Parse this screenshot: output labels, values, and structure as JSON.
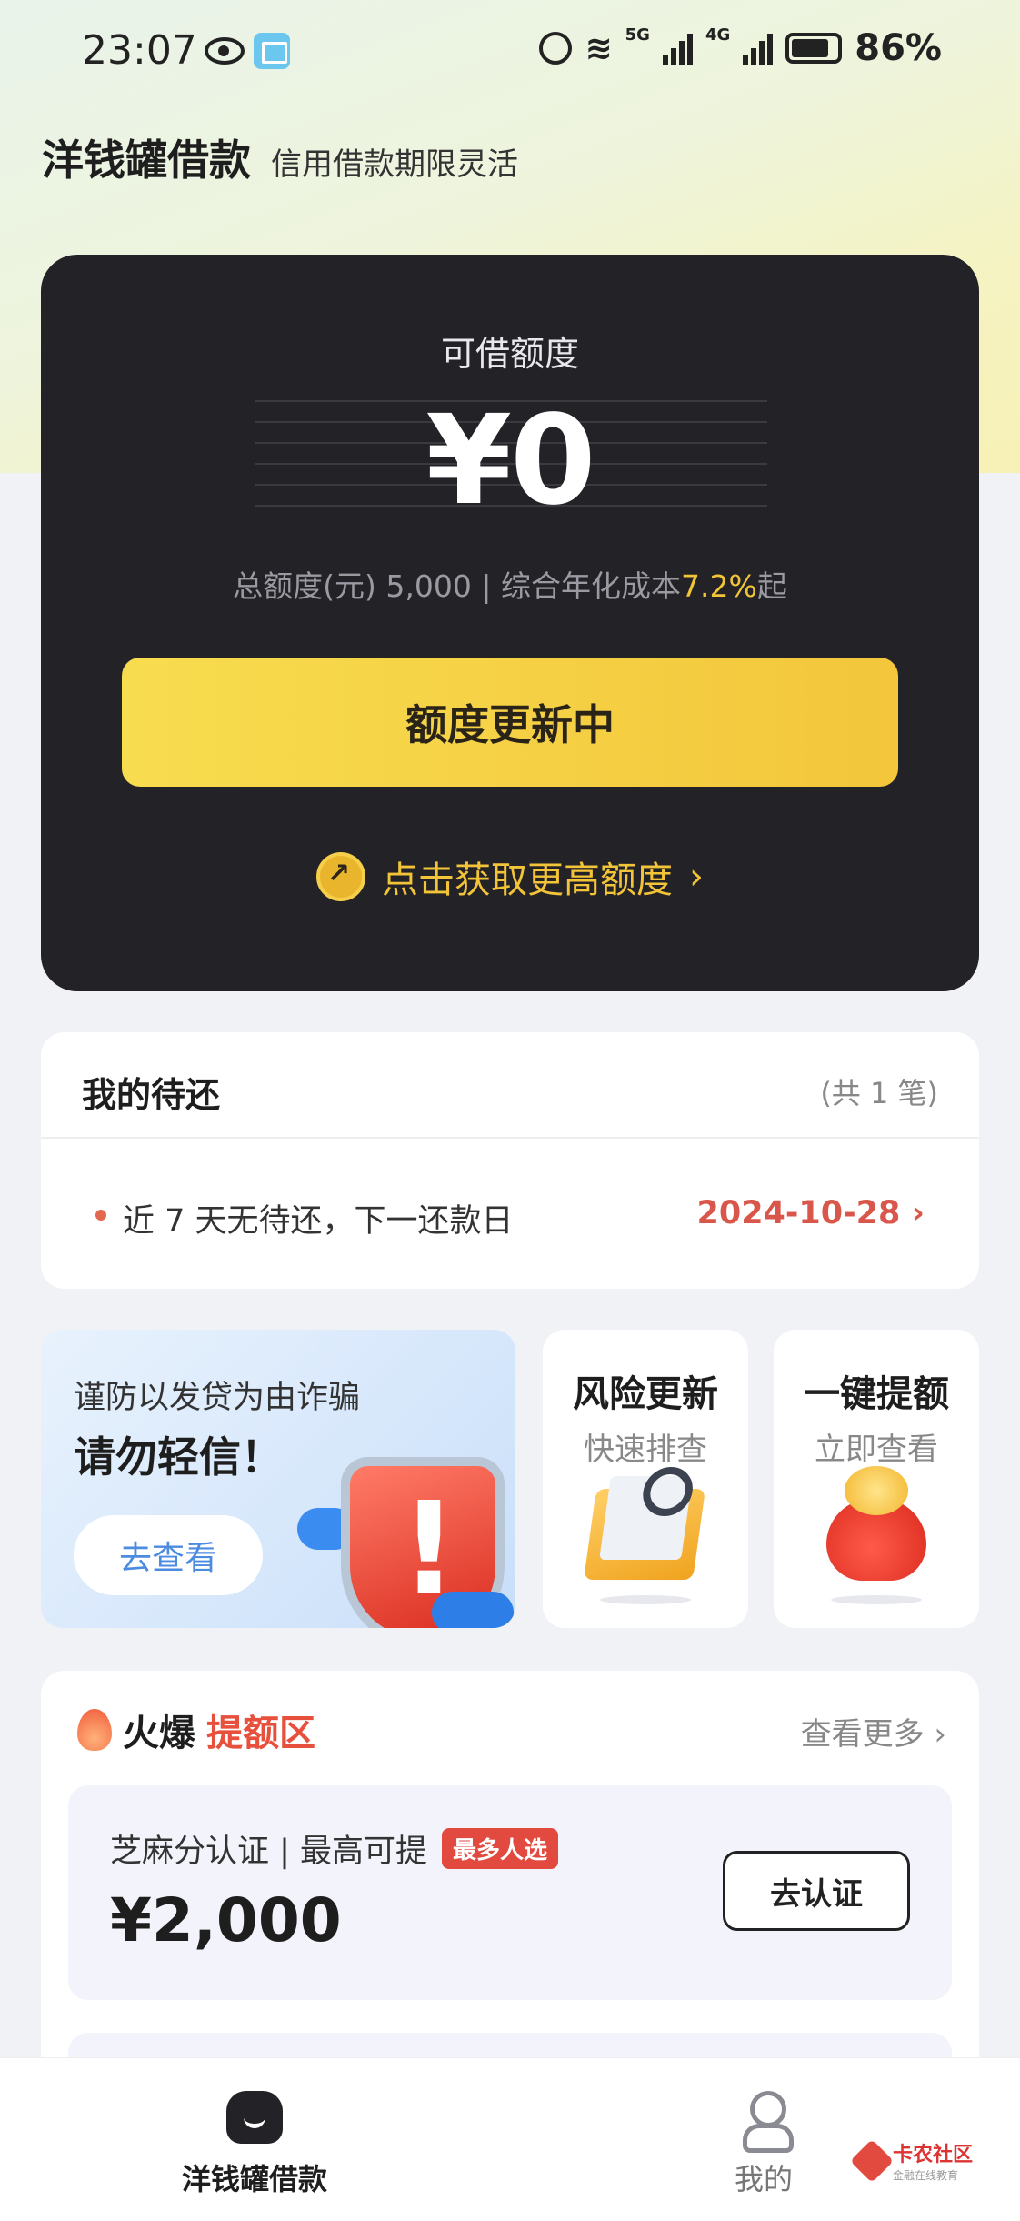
{
  "status_bar": {
    "time": "23:07",
    "battery": "86%",
    "net1": "5G",
    "net2": "4G"
  },
  "header": {
    "brand": "洋钱罐借款",
    "subtitle": "信用借款期限灵活"
  },
  "credit_card": {
    "label": "可借额度",
    "amount": "¥0",
    "total_prefix": "总额度(元) 5,000 | 综合年化成本",
    "rate": "7.2%",
    "rate_suffix": "起",
    "button": "额度更新中",
    "more_link": "点击获取更高额度"
  },
  "repayment": {
    "title": "我的待还",
    "count": "(共 1 笔)",
    "text": "近 7 天无待还，下一还款日",
    "date": "2024-10-28"
  },
  "promo": {
    "fraud_line1": "谨防以发贷为由诈骗",
    "fraud_line2": "请勿轻信！",
    "fraud_button": "去查看",
    "tile1_title": "风险更新",
    "tile1_sub": "快速排查",
    "tile2_title": "一键提额",
    "tile2_sub": "立即查看"
  },
  "hot_zone": {
    "title_plain": "火爆",
    "title_accent": "提额区",
    "more": "查看更多",
    "offer": {
      "desc": "芝麻分认证 | 最高可提",
      "badge": "最多人选",
      "amount": "¥2,000",
      "button": "去认证"
    }
  },
  "tabbar": {
    "tab1": "洋钱罐借款",
    "tab2": "我的"
  },
  "watermark": {
    "name": "卡农社区",
    "sub": "金融在线教育"
  },
  "colors": {
    "accent_yellow": "#f3c438",
    "dark_card": "#232327",
    "alert_red": "#e2493f",
    "date_red": "#d9574a"
  }
}
